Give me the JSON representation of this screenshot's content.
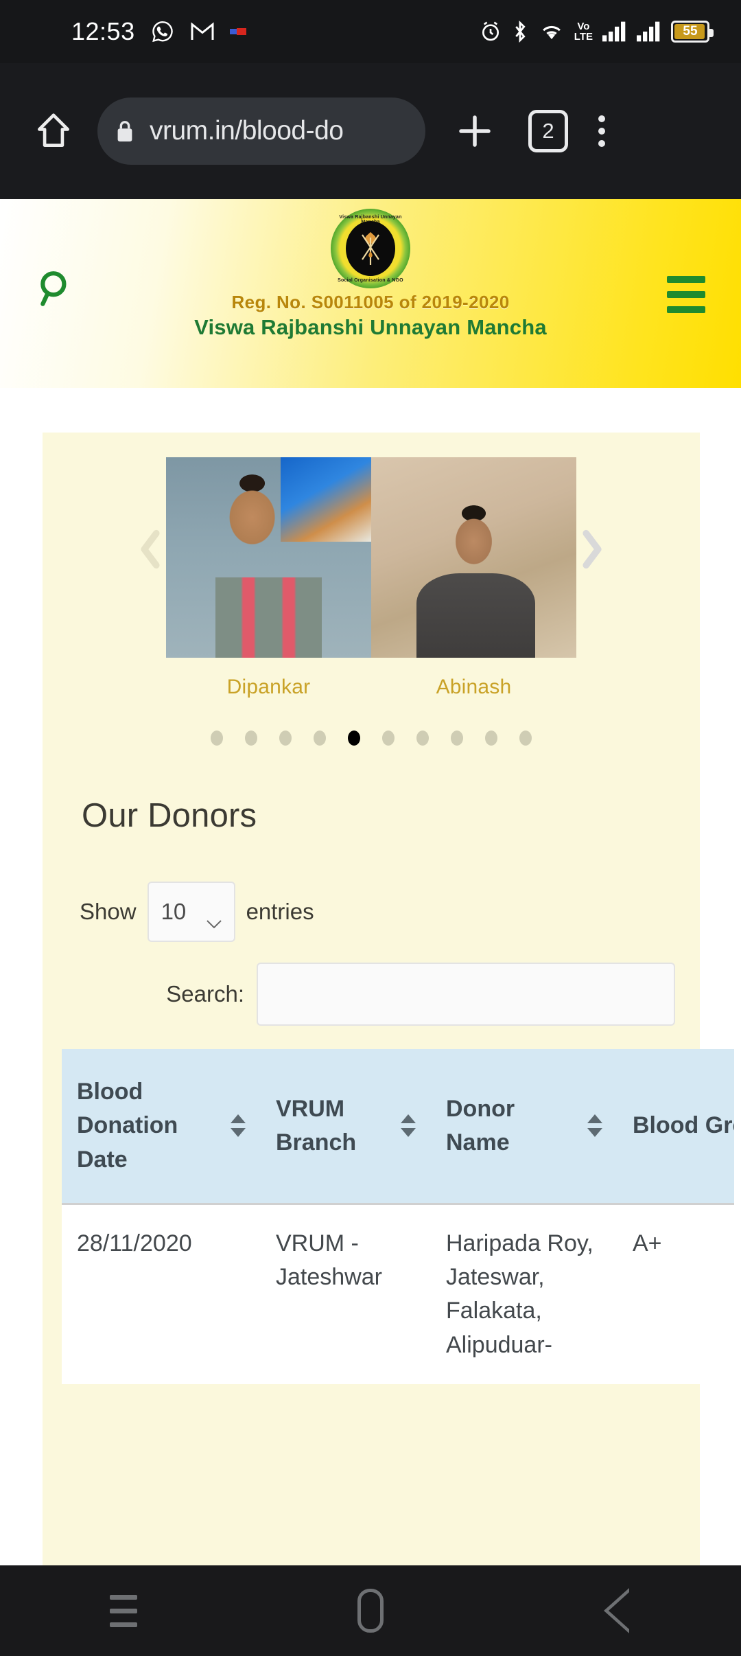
{
  "status_bar": {
    "time": "12:53",
    "left_icons": [
      "whatsapp-icon",
      "gmail-icon",
      "notification-icon"
    ],
    "right_icons": [
      "alarm-icon",
      "bluetooth-icon",
      "wifi-icon",
      "volte-icon",
      "signal-1-icon",
      "signal-2-icon"
    ],
    "volte_line1": "Vo",
    "volte_line2": "LTE",
    "battery_percent": "55"
  },
  "browser": {
    "home_icon": "home-icon",
    "lock_icon": "lock-icon",
    "url": "vrum.in/blood-do",
    "new_tab_icon": "plus-icon",
    "tab_count": "2",
    "menu_icon": "three-dot-menu-icon"
  },
  "site_header": {
    "search_icon": "search-icon",
    "menu_icon": "hamburger-menu-icon",
    "logo": {
      "icon": "vrum-logo-icon",
      "text_top": "Viswa Rajbanshi Unnayan Mancha",
      "text_bottom": "Social Organisation & NGO"
    },
    "registration": "Reg. No. S0011005 of 2019-2020",
    "org_name": "Viswa Rajbanshi Unnayan Mancha",
    "accent_green": "#1f8b2e",
    "accent_gold": "#b8860b"
  },
  "carousel": {
    "prev_icon": "chevron-left-icon",
    "next_icon": "chevron-right-icon",
    "slides": [
      {
        "name": "Dipankar",
        "photo": "donor-photo-dipankar"
      },
      {
        "name": "Abinash",
        "photo": "donor-photo-abinash"
      }
    ],
    "dot_count": 10,
    "active_dot_index": 4
  },
  "donors_section": {
    "title": "Our Donors",
    "length_label_before": "Show",
    "length_value": "10",
    "length_label_after": "entries",
    "length_chevron_icon": "chevron-down-icon",
    "search_label": "Search:",
    "search_value": "",
    "search_placeholder": ""
  },
  "table": {
    "columns": [
      {
        "label": "Blood Donation Date",
        "sort_icon": "sort-updown-icon"
      },
      {
        "label": "VRUM Branch",
        "sort_icon": "sort-updown-icon"
      },
      {
        "label": "Donor Name",
        "sort_icon": "sort-updown-icon"
      },
      {
        "label": "Blood Group",
        "sort_icon": "sort-updown-icon"
      }
    ],
    "rows": [
      {
        "date": "28/11/2020",
        "branch": "VRUM - Jateshwar",
        "donor_name": "Haripada Roy, Jateswar, Falakata, Alipuduar-",
        "blood_group": "A+"
      }
    ],
    "header_bg": "#d5e8f3"
  },
  "nav_bar": {
    "recents_icon": "recents-icon",
    "home_icon": "home-square-icon",
    "back_icon": "back-triangle-icon"
  }
}
